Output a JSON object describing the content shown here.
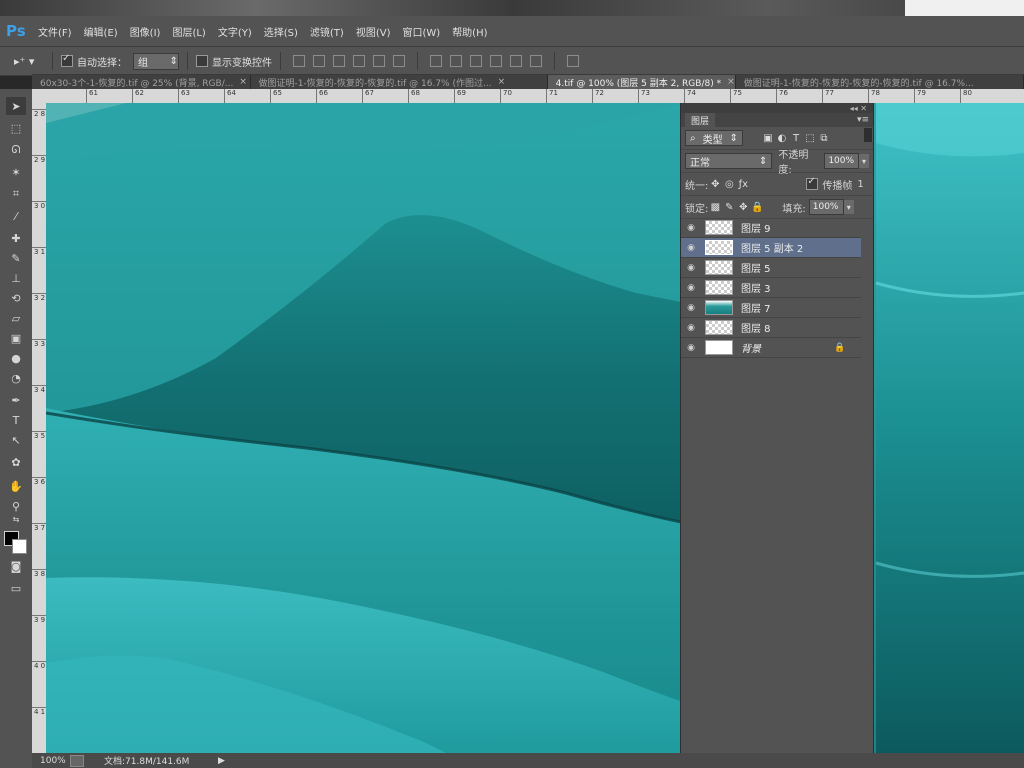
{
  "app": {
    "logo": "Ps"
  },
  "menu": [
    "文件(F)",
    "编辑(E)",
    "图像(I)",
    "图层(L)",
    "文字(Y)",
    "选择(S)",
    "滤镜(T)",
    "视图(V)",
    "窗口(W)",
    "帮助(H)"
  ],
  "options": {
    "auto_select_label": "自动选择：",
    "auto_select_value": "组",
    "show_transform_label": "显示变换控件"
  },
  "tabs": [
    {
      "label": "60x30-3个-1-恢复的.tif @ 25% (背景, RGB/...",
      "close": "×"
    },
    {
      "label": "做图证明-1-恢复的-恢复的-恢复的.tif @ 16.7% (作图过...",
      "close": "×"
    },
    {
      "label": "4.tif @ 100% (图层 5 副本 2, RGB/8) *",
      "close": "×"
    },
    {
      "label": "做图证明-1-恢复的-恢复的-恢复的-恢复的.tif @ 16.7%...",
      "close": ""
    }
  ],
  "ruler_h": [
    "61",
    "62",
    "63",
    "64",
    "65",
    "66",
    "67",
    "68",
    "69",
    "70",
    "71",
    "72",
    "73",
    "74",
    "75",
    "76",
    "77",
    "78",
    "79",
    "80"
  ],
  "ruler_v": [
    "2 8",
    "2 9",
    "3 0",
    "3 1",
    "3 2",
    "3 3",
    "3 4",
    "3 5",
    "3 6",
    "3 7",
    "3 8",
    "3 9",
    "4 0",
    "4 1"
  ],
  "panel": {
    "tab": "图层",
    "filter_label": "类型",
    "blend_mode": "正常",
    "opacity_label": "不透明度:",
    "opacity_value": "100%",
    "unify_label": "统一:",
    "propagate_label": "传播帧",
    "propagate_value": "1",
    "lock_label": "锁定:",
    "fill_label": "填充:",
    "fill_value": "100%"
  },
  "layers": [
    {
      "name": "图层 9",
      "thumb": "checker",
      "selected": false
    },
    {
      "name": "图层 5 副本 2",
      "thumb": "checker",
      "selected": true
    },
    {
      "name": "图层 5",
      "thumb": "checker",
      "selected": false
    },
    {
      "name": "图层 3",
      "thumb": "checker",
      "selected": false
    },
    {
      "name": "图层 7",
      "thumb": "teal",
      "selected": false
    },
    {
      "name": "图层 8",
      "thumb": "checker",
      "selected": false
    },
    {
      "name": "背景",
      "thumb": "white",
      "selected": false,
      "locked": true
    }
  ],
  "status": {
    "zoom": "100%",
    "doc": "文档:71.8M/141.6M"
  },
  "colors": {
    "teal_dark": "#137373",
    "teal_mid": "#1f9496",
    "teal_light": "#45c0c4",
    "chrome": "#535353"
  }
}
